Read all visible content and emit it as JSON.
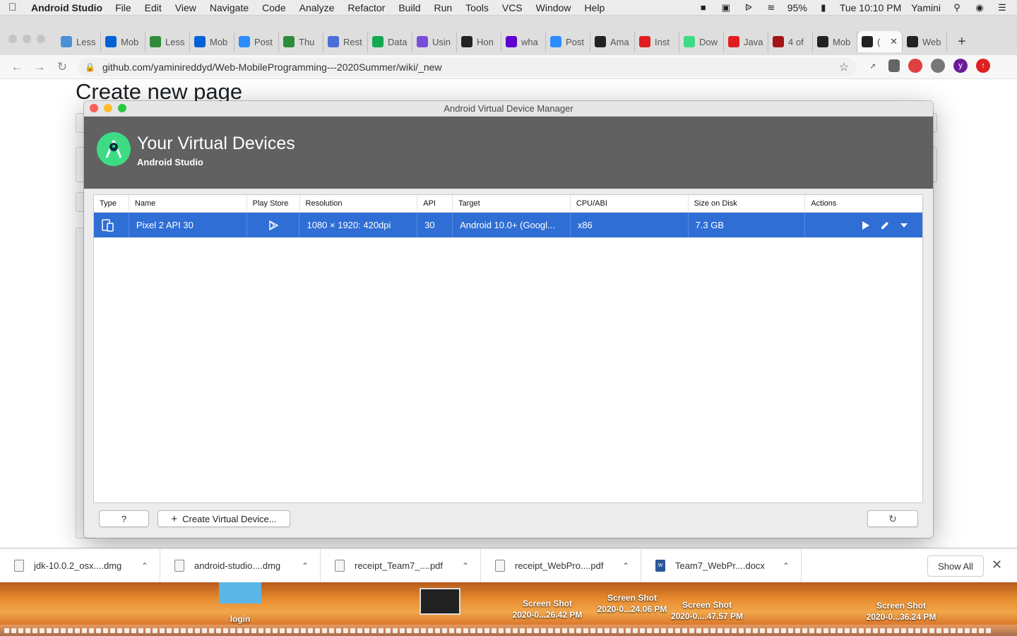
{
  "menubar": {
    "app_name": "Android Studio",
    "items": [
      "File",
      "Edit",
      "View",
      "Navigate",
      "Code",
      "Analyze",
      "Refactor",
      "Build",
      "Run",
      "Tools",
      "VCS",
      "Window",
      "Help"
    ],
    "battery": "95%",
    "clock": "Tue 10:10 PM",
    "user": "Yamini"
  },
  "browser": {
    "tabs": [
      {
        "title": "Less",
        "icon": "unc-icon",
        "color": "#4a90d9"
      },
      {
        "title": "Mob",
        "icon": "box-icon",
        "color": "#0061d5"
      },
      {
        "title": "Less",
        "icon": "green-leaf-icon",
        "color": "#2e8b3a"
      },
      {
        "title": "Mob",
        "icon": "box-icon",
        "color": "#0061d5"
      },
      {
        "title": "Post",
        "icon": "zoom-icon",
        "color": "#2d8cff"
      },
      {
        "title": "Thu",
        "icon": "green-leaf-icon",
        "color": "#2e8b3a"
      },
      {
        "title": "Rest",
        "icon": "api-icon",
        "color": "#4a6fd8"
      },
      {
        "title": "Data",
        "icon": "mongodb-icon",
        "color": "#13aa52"
      },
      {
        "title": "Usin",
        "icon": "code-icon",
        "color": "#7a4fd8"
      },
      {
        "title": "Hon",
        "icon": "github-icon",
        "color": "#222"
      },
      {
        "title": "wha",
        "icon": "yahoo-icon",
        "color": "#6001d2"
      },
      {
        "title": "Post",
        "icon": "zoom-icon",
        "color": "#2d8cff"
      },
      {
        "title": "Ama",
        "icon": "amazon-icon",
        "color": "#222"
      },
      {
        "title": "Inst",
        "icon": "oracle-icon",
        "color": "#e01e1e"
      },
      {
        "title": "Dow",
        "icon": "android-icon",
        "color": "#3ddc84"
      },
      {
        "title": "Java",
        "icon": "oracle-icon",
        "color": "#e01e1e"
      },
      {
        "title": "4 of",
        "icon": "m-icon",
        "color": "#a31515"
      },
      {
        "title": "Mob",
        "icon": "github-icon",
        "color": "#222"
      },
      {
        "title": "(",
        "icon": "github-icon",
        "color": "#222"
      },
      {
        "title": "Web",
        "icon": "github-icon",
        "color": "#222"
      }
    ],
    "url": "github.com/yaminireddyd/Web-MobileProgramming---2020Summer/wiki/_new"
  },
  "webpage": {
    "title": "Create new page"
  },
  "avd": {
    "window_title": "Android Virtual Device Manager",
    "header_title": "Your Virtual Devices",
    "header_subtitle": "Android Studio",
    "columns": [
      "Type",
      "Name",
      "Play Store",
      "Resolution",
      "API",
      "Target",
      "CPU/ABI",
      "Size on Disk",
      "Actions"
    ],
    "devices": [
      {
        "name": "Pixel 2 API 30",
        "resolution": "1080 × 1920: 420dpi",
        "api": "30",
        "target": "Android 10.0+ (Googl...",
        "cpu": "x86",
        "size": "7.3 GB"
      }
    ],
    "help_label": "?",
    "create_label": "Create Virtual Device...",
    "colors": {
      "selection": "#2f6ed5",
      "header": "#616161",
      "logo": "#3ddc84"
    }
  },
  "downloads": {
    "items": [
      {
        "name": "jdk-10.0.2_osx....dmg",
        "icon": "dmg-file-icon"
      },
      {
        "name": "android-studio....dmg",
        "icon": "dmg-file-icon"
      },
      {
        "name": "receipt_Team7_....pdf",
        "icon": "pdf-file-icon"
      },
      {
        "name": "receipt_WebPro....pdf",
        "icon": "pdf-file-icon"
      },
      {
        "name": "Team7_WebPr....docx",
        "icon": "word-file-icon"
      }
    ],
    "show_all": "Show All"
  },
  "desktop": {
    "icons": [
      {
        "line1": "login",
        "line2": ""
      },
      {
        "line1": "Screen Shot",
        "line2": "2020-0...26.42 PM"
      },
      {
        "line1": "Screen Shot",
        "line2": "2020-0...24.06 PM"
      },
      {
        "line1": "Screen Shot",
        "line2": "2020-0....47.57 PM"
      },
      {
        "line1": "Screen Shot",
        "line2": "2020-0...36.24 PM"
      }
    ]
  }
}
